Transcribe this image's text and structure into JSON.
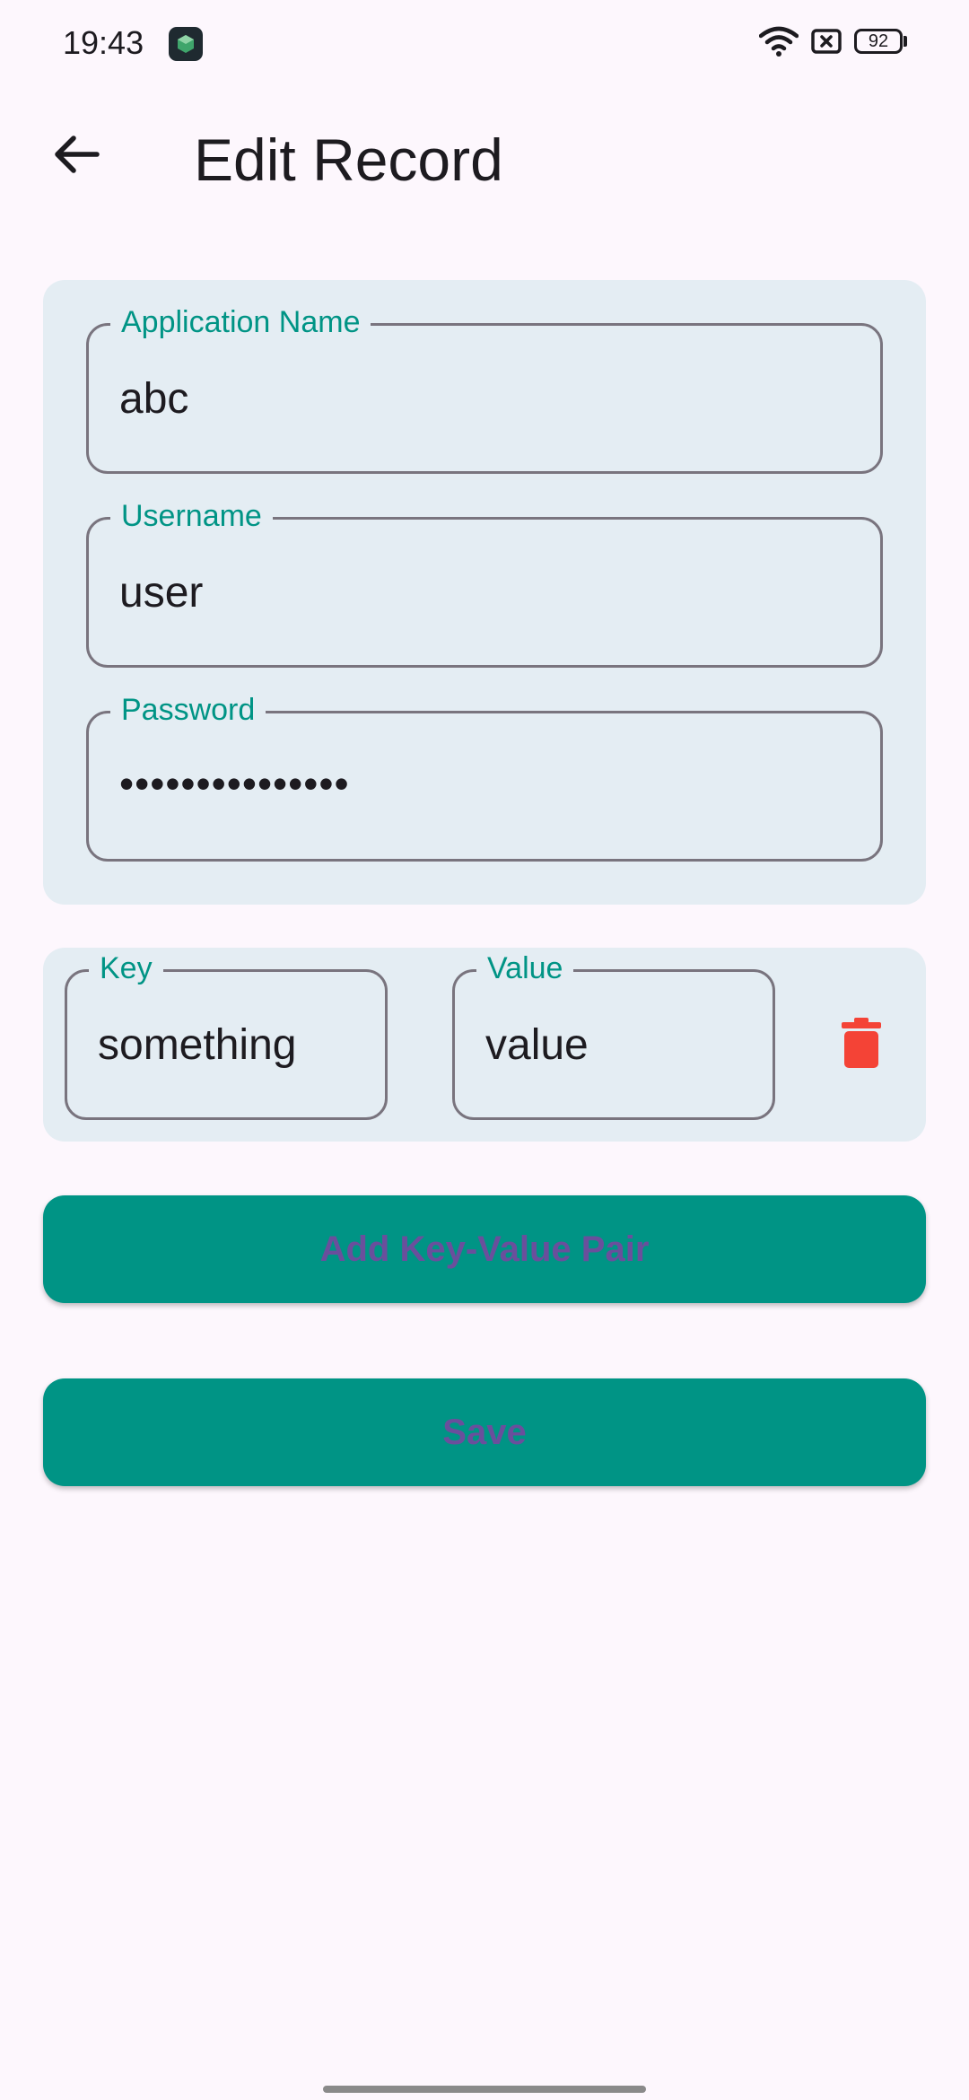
{
  "status_bar": {
    "time": "19:43",
    "battery": "92",
    "icons": [
      "app-icon",
      "wifi-icon",
      "no-sim-icon",
      "battery-icon"
    ]
  },
  "app_bar": {
    "back_icon": "arrow-left-icon",
    "title": "Edit Record"
  },
  "record": {
    "application_name": {
      "label": "Application Name",
      "value": "abc"
    },
    "username": {
      "label": "Username",
      "value": "user"
    },
    "password": {
      "label": "Password",
      "value": "•••••••••••••••"
    }
  },
  "key_value_pairs": [
    {
      "key_label": "Key",
      "key": "something",
      "value_label": "Value",
      "value": "value",
      "delete_icon": "trash-icon"
    }
  ],
  "actions": {
    "add_pair_label": "Add Key-Value Pair",
    "save_label": "Save"
  },
  "colors": {
    "background": "#fdf7fd",
    "card": "#e4edf3",
    "accent": "#009485",
    "button_text": "#6a4f9c",
    "delete": "#f44336",
    "outline": "#79747e"
  }
}
